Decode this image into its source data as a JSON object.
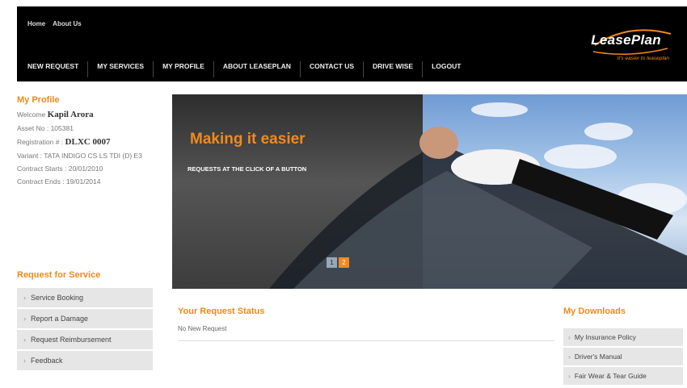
{
  "header": {
    "top_links": [
      "Home",
      "About Us"
    ],
    "nav": [
      "NEW REQUEST",
      "MY SERVICES",
      "MY PROFILE",
      "ABOUT LEASEPLAN",
      "CONTACT US",
      "DRIVE WISE",
      "LOGOUT"
    ],
    "logo_text": "LeasePlan",
    "tagline": "It's easier to leaseplan",
    "logo_color": "#f08a1c"
  },
  "profile": {
    "title": "My Profile",
    "welcome_label": "Welcome",
    "name": "Kapil Arora",
    "asset": "Asset No : 105381",
    "registration_label": "Registration # :",
    "registration": "DLXC 0007",
    "variant": "Variant : TATA INDIGO CS LS TDI (D) E3",
    "contract_starts": "Contract Starts : 20/01/2010",
    "contract_ends": "Contract Ends : 19/01/2014"
  },
  "request": {
    "title": "Request for Service",
    "items": [
      "Service Booking",
      "Report a Damage",
      "Request Reimbursement",
      "Feedback"
    ]
  },
  "banner": {
    "title": "Making it easier",
    "subtitle": "REQUESTS AT THE CLICK OF A BUTTON",
    "pages": [
      "1",
      "2"
    ],
    "active_page": 2
  },
  "status": {
    "title": "Your Request Status",
    "message": "No New Request"
  },
  "downloads": {
    "title": "My Downloads",
    "items": [
      "My Insurance Policy",
      "Driver's Manual",
      "Fair Wear & Tear Guide"
    ]
  }
}
